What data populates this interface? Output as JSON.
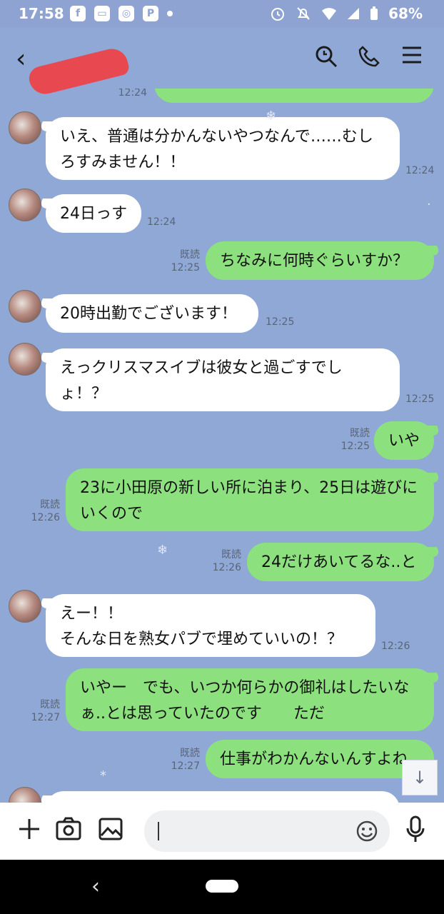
{
  "status": {
    "time": "17:58",
    "battery": "68%"
  },
  "messages": {
    "m0": {
      "meta": "12:24"
    },
    "m1": {
      "text": "いえ、普通は分かんないやつなんで……むしろすみません！！",
      "meta": "12:24"
    },
    "m2": {
      "text": "24日っす",
      "meta": "12:24"
    },
    "m3": {
      "text": "ちなみに何時ぐらいすか？",
      "read": "既読",
      "meta": "12:25"
    },
    "m4": {
      "text": "20時出勤でございます！",
      "meta": "12:25"
    },
    "m5": {
      "text": "えっクリスマスイブは彼女と過ごすでしょ！？",
      "meta": "12:25"
    },
    "m6": {
      "text": "いや",
      "read": "既読",
      "meta": "12:25"
    },
    "m7": {
      "text": "23に小田原の新しい所に泊まり、25日は遊びにいくので",
      "read": "既読",
      "meta": "12:26"
    },
    "m8": {
      "text": "24だけあいてるな..と",
      "read": "既読",
      "meta": "12:26"
    },
    "m9": {
      "line1": "えー！！",
      "line2": "そんな日を熟女パブで埋めていいの！？",
      "meta": "12:26"
    },
    "m10": {
      "text": "いやー　でも、いつか何らかの御礼はしたいなぁ..とは思っていたのです　　ただ",
      "read": "既読",
      "meta": "12:27"
    },
    "m11": {
      "text": "仕事がわかんないんすよね",
      "read": "既読",
      "meta": "12:27"
    }
  },
  "icons": {
    "back": "chevron-left-icon",
    "search": "search-icon",
    "call": "phone-icon",
    "menu": "menu-icon",
    "scroll": "arrow-down-icon",
    "plus": "plus-icon",
    "camera": "camera-icon",
    "image": "image-icon",
    "emoji": "smile-icon",
    "mic": "mic-icon"
  },
  "colors": {
    "background": "#8fa8d6",
    "outgoing": "#8ce07d",
    "incoming": "#ffffff"
  }
}
